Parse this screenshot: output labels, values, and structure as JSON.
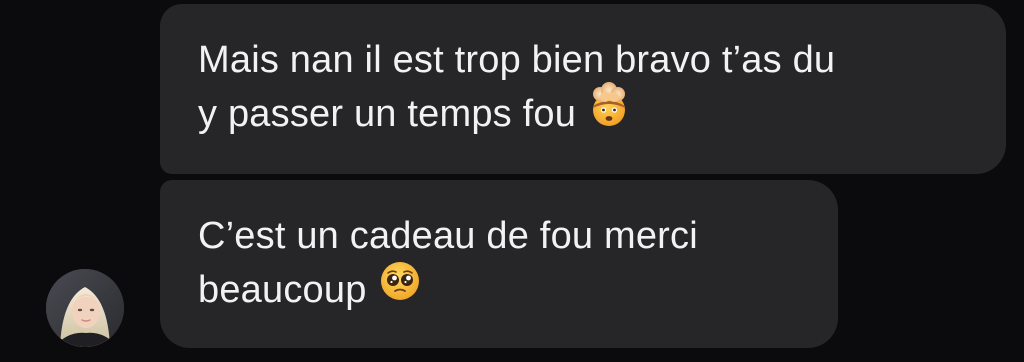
{
  "messages": [
    {
      "lines": [
        "Mais nan il est trop bien bravo t’as du",
        "y passer un temps fou"
      ],
      "emoji": "exploding-head"
    },
    {
      "lines": [
        "C’est un cadeau de fou merci",
        "beaucoup"
      ],
      "emoji": "pleading-face"
    }
  ],
  "colors": {
    "background": "#0b0b0d",
    "bubble": "#262629",
    "text": "#f2f2f4"
  }
}
